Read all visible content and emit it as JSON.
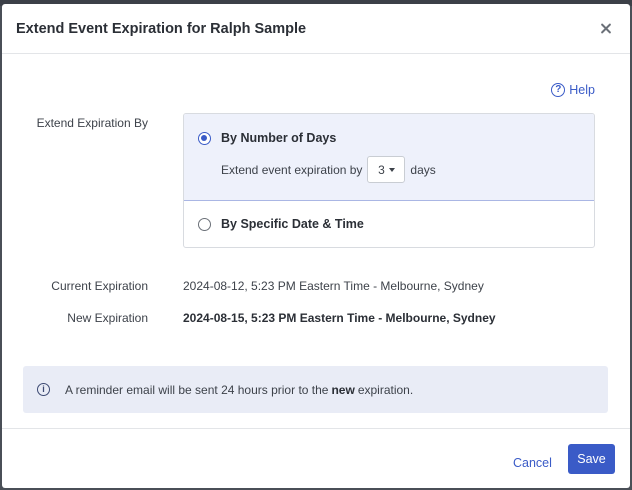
{
  "modal": {
    "title": "Extend Event Expiration for Ralph Sample",
    "help_label": "Help"
  },
  "form": {
    "extend_by_label": "Extend Expiration By",
    "option_days_label": "By Number of Days",
    "extend_prefix": "Extend event expiration by",
    "days_value": "3",
    "days_suffix": "days",
    "option_date_label": "By Specific Date & Time",
    "selected_option": "By Number of Days"
  },
  "expiration": {
    "current_label": "Current Expiration",
    "current_value": "2024-08-12, 5:23 PM Eastern Time - Melbourne, Sydney",
    "new_label": "New Expiration",
    "new_value": "2024-08-15, 5:23 PM Eastern Time - Melbourne, Sydney"
  },
  "info": {
    "text_before": "A reminder email will be sent 24 hours prior to the",
    "text_strong": "new",
    "text_after": "expiration."
  },
  "footer": {
    "cancel_label": "Cancel",
    "save_label": "Save"
  },
  "colors": {
    "accent": "#3a5bc7",
    "selected_bg": "#eef1fb",
    "banner_bg": "#e9ecf6"
  },
  "icons": {
    "close": "close-icon",
    "help": "question-circle-icon",
    "info": "info-circle-icon",
    "caret": "caret-down-icon"
  }
}
